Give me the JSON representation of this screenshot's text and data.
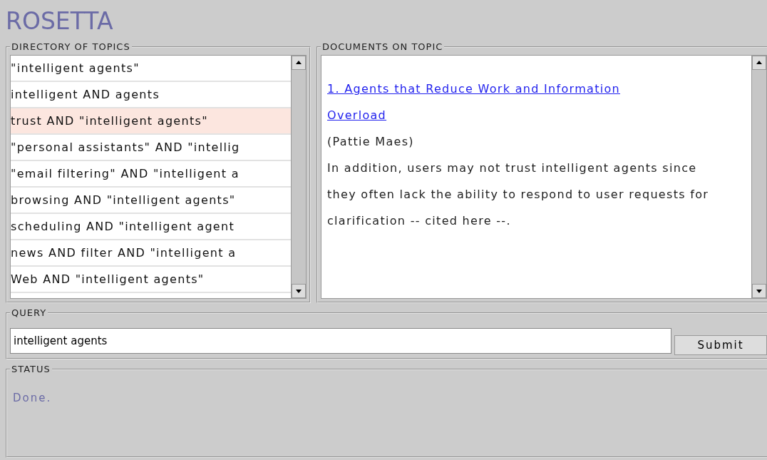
{
  "app_title": "ROSETTA",
  "directory": {
    "legend": "DIRECTORY OF TOPICS",
    "topics": [
      {
        "label": "\"intelligent agents\"",
        "selected": false
      },
      {
        "label": "intelligent AND agents",
        "selected": false
      },
      {
        "label": "trust AND \"intelligent agents\"",
        "selected": true
      },
      {
        "label": "\"personal assistants\" AND \"intellig",
        "selected": false
      },
      {
        "label": "\"email filtering\" AND \"intelligent a",
        "selected": false
      },
      {
        "label": "browsing AND \"intelligent agents\"",
        "selected": false
      },
      {
        "label": "scheduling AND \"intelligent agent",
        "selected": false
      },
      {
        "label": "news AND filter AND \"intelligent a",
        "selected": false
      },
      {
        "label": "Web AND \"intelligent agents\"",
        "selected": false
      }
    ]
  },
  "documents": {
    "legend": "DOCUMENTS ON TOPIC",
    "results": [
      {
        "title": "1. Agents that Reduce Work and Information Overload",
        "author": "(Pattie Maes)",
        "excerpt": "In addition, users may not trust intelligent agents since they often lack the ability to respond to user requests for clarification -- cited here --."
      }
    ]
  },
  "query": {
    "legend": "QUERY",
    "value": "intelligent agents",
    "button": "Submit"
  },
  "status": {
    "legend": "STATUS",
    "message": "Done."
  }
}
